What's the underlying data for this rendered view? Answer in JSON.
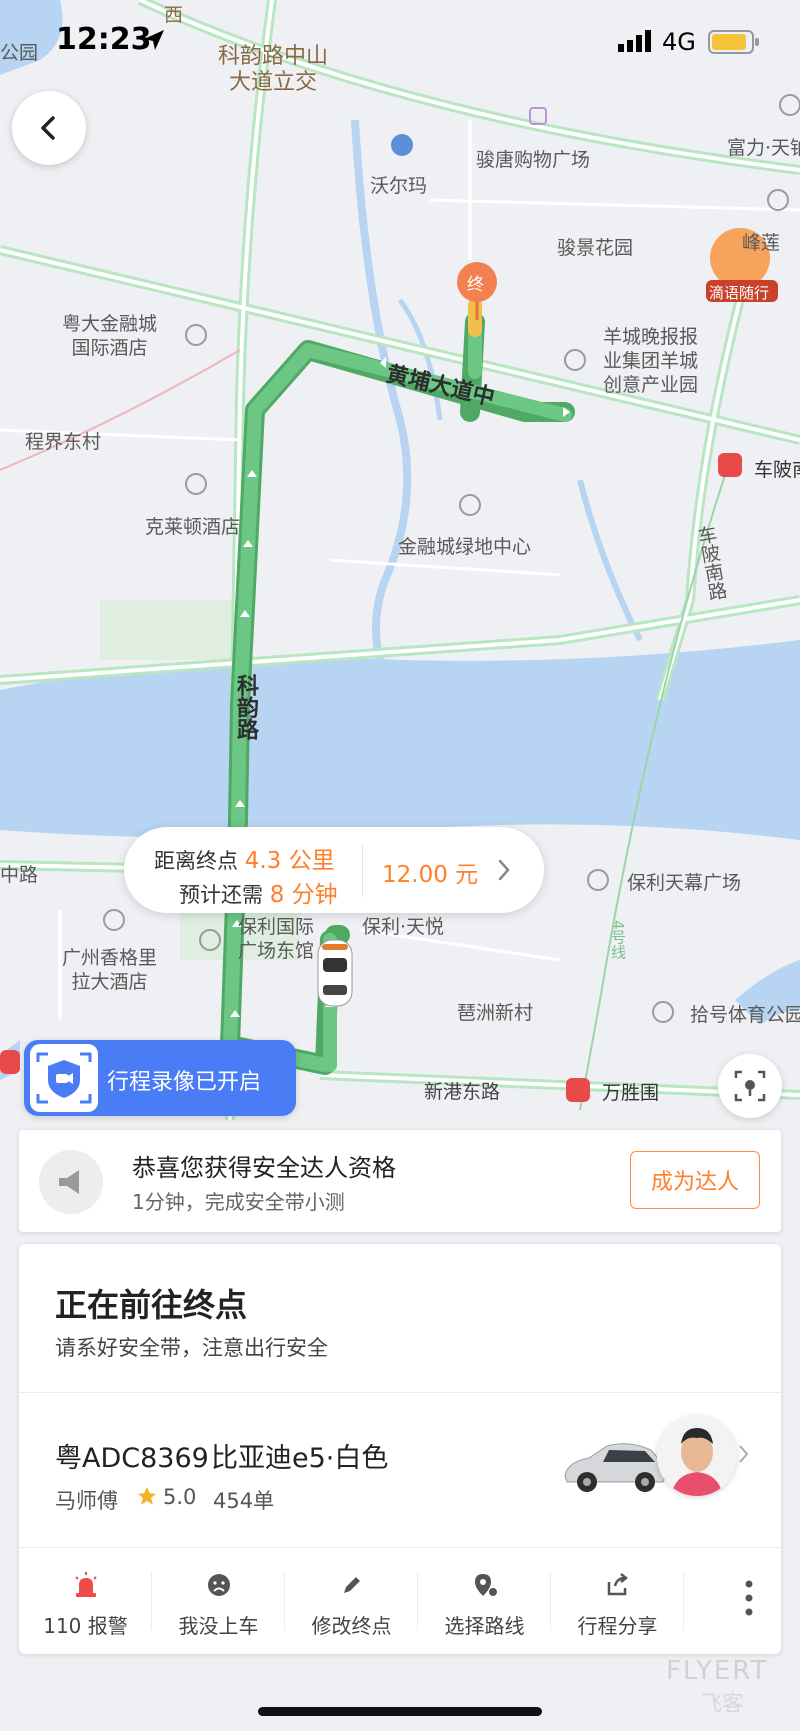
{
  "status_bar": {
    "time": "12:23",
    "network": "4G"
  },
  "map": {
    "labels": {
      "interchange": "科韵路中山\n大道立交",
      "junjing_mall": "骏唐购物广场",
      "walmart": "沃尔玛",
      "fuli": "富力·天铂",
      "junjing_garden": "骏景花园",
      "yuecai_hotel": "粤大金融城\n国际酒店",
      "yangcheng": "羊城晚报报\n业集团羊城\n创意产业园",
      "huangpu_road": "黄埔大道中",
      "chengjie": "程界东村",
      "chebei_station": "车陂南",
      "kelaidun": "克莱顿酒店",
      "jinrong_green": "金融城绿地中心",
      "chebei_road": "车陂南路",
      "keyun_road": "科韵路",
      "zhonglu": "中路",
      "poly_sky": "保利天幕广场",
      "baoli_east": "保利国际\n广场东馆",
      "baoli_tianyue": "保利·天悦",
      "shangri_la": "广州香格里\n拉大酒店",
      "pazhou": "琶洲新村",
      "stadium": "拾号体育公园",
      "xingang_road": "新港东路",
      "wanshengwei": "万胜围",
      "dest_marker": "终",
      "line4": "4号线",
      "promo_float": "滴语随行",
      "top_park": "公园",
      "top_west": "西",
      "fengli": "峰莲"
    }
  },
  "trip_bubble": {
    "distance_prefix": "距离终点",
    "distance_value": "4.3 公里",
    "time_prefix": "预计还需",
    "time_value": "8 分钟",
    "fare": "12.00 元"
  },
  "recording": {
    "label": "行程录像已开启"
  },
  "promo": {
    "title": "恭喜您获得安全达人资格",
    "subtitle": "1分钟，完成安全带小测",
    "button": "成为达人"
  },
  "trip_card": {
    "title": "正在前往终点",
    "subtitle": "请系好安全带，注意出行安全",
    "plate": "粤ADC8369",
    "car_model": "比亚迪e5·白色",
    "driver": "马师傅",
    "rating": "5.0",
    "orders": "454单"
  },
  "actions": [
    {
      "label": "110 报警",
      "icon": "alarm-icon"
    },
    {
      "label": "我没上车",
      "icon": "sad-face-icon"
    },
    {
      "label": "修改终点",
      "icon": "pencil-icon"
    },
    {
      "label": "选择路线",
      "icon": "route-pin-icon"
    },
    {
      "label": "行程分享",
      "icon": "share-icon"
    }
  ],
  "watermark": {
    "line1": "FLYERT",
    "line2": "飞客"
  },
  "colors": {
    "route": "#5bbd74",
    "accent": "#ff7f2a",
    "rec_blue": "#4a7cf6"
  }
}
